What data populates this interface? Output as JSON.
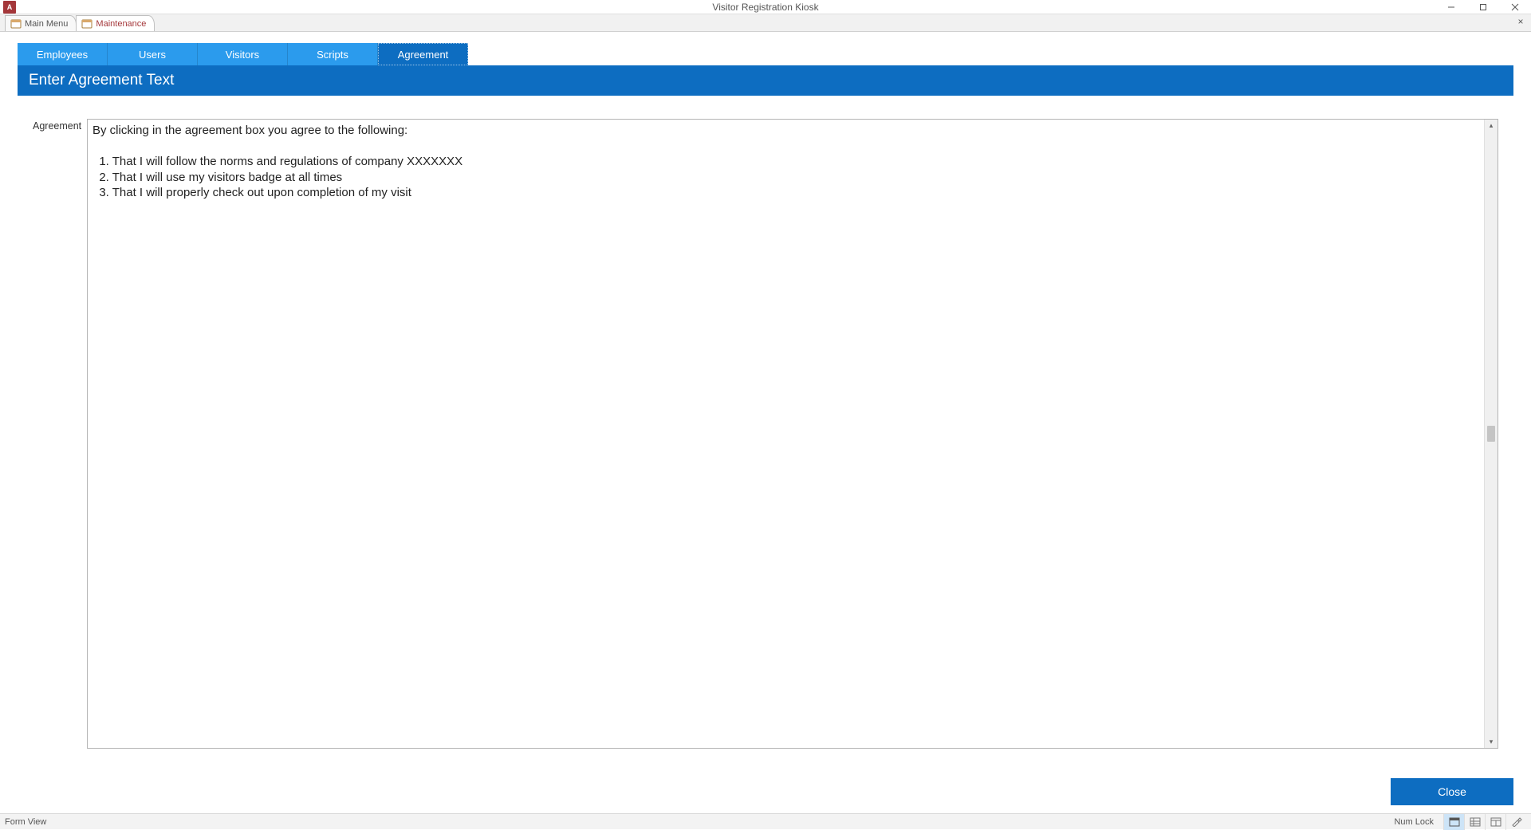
{
  "app": {
    "title": "Visitor Registration Kiosk",
    "icon_label": "A"
  },
  "doc_tabs": {
    "items": [
      {
        "label": "Main Menu",
        "active": false
      },
      {
        "label": "Maintenance",
        "active": true
      }
    ]
  },
  "nav_tabs": {
    "items": [
      {
        "label": "Employees",
        "selected": false
      },
      {
        "label": "Users",
        "selected": false
      },
      {
        "label": "Visitors",
        "selected": false
      },
      {
        "label": "Scripts",
        "selected": false
      },
      {
        "label": "Agreement",
        "selected": true
      }
    ]
  },
  "page": {
    "header": "Enter Agreement Text",
    "field_label": "Agreement",
    "agreement_text": "By clicking in the agreement box you agree to the following:\n\n  1. That I will follow the norms and regulations of company XXXXXXX\n  2. That I will use my visitors badge at all times\n  3. That I will properly check out upon completion of my visit"
  },
  "buttons": {
    "close": "Close"
  },
  "statusbar": {
    "left": "Form View",
    "numlock": "Num Lock"
  }
}
